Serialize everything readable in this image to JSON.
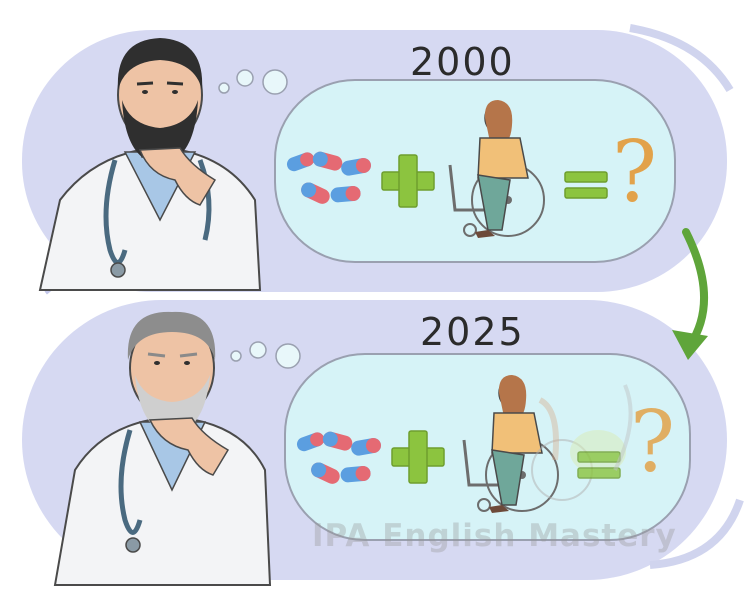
{
  "panels": {
    "top": {
      "year": "2000"
    },
    "bottom": {
      "year": "2025"
    }
  },
  "symbols": {
    "plus": "+",
    "equals": "=",
    "question": "?"
  },
  "watermark": "IPA English Mastery",
  "colors": {
    "panel_bg": "#d6d9f2",
    "bubble_bg": "#d6f3f7",
    "bubble_border": "#9aa0b0",
    "plus_green": "#8cc43f",
    "question_orange": "#e2a24a",
    "arrow_green": "#5fa53a",
    "pill_red": "#e56a73",
    "pill_blue": "#5b9ee0",
    "coat": "#f3f4f6",
    "outline": "#4a4a4a"
  },
  "icons": [
    "thinking-doctor-young",
    "thinking-doctor-old",
    "thought-bubble",
    "pills-icon",
    "plus-icon",
    "wheelchair-woman-icon",
    "equals-icon",
    "question-mark-icon",
    "curved-arrow-icon"
  ]
}
